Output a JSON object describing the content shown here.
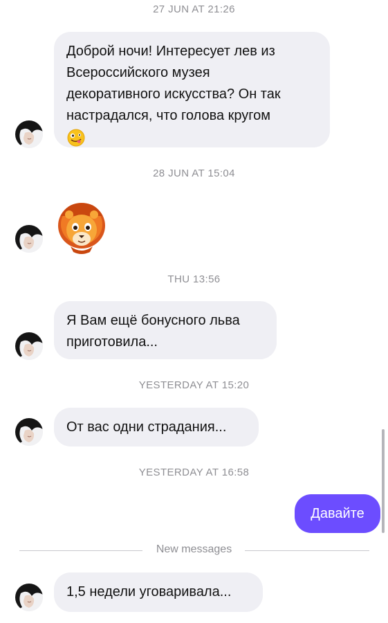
{
  "conversation": {
    "timestamps": {
      "t1": "27 JUN AT 21:26",
      "t2": "28 JUN AT 15:04",
      "t3": "THU 13:56",
      "t4": "YESTERDAY AT 15:20",
      "t5": "YESTERDAY AT 16:58"
    },
    "messages": {
      "m1_line1": "Доброй ночи! Интересует лев из",
      "m1_line2": "Всероссийского музея",
      "m1_line3": "декоративного искусства? Он так",
      "m1_line4": "настрадался, что голова кругом",
      "m1_emoji": "zany-face-emoji",
      "m2_sticker": "lion-memoji-sticker",
      "m3_line1": "Я Вам ещё бонусного льва",
      "m3_line2": "приготовила...",
      "m4": "От вас одни страдания...",
      "m5_outgoing": "Давайте",
      "m6": "1,5 недели уговаривала..."
    },
    "new_messages_label": "New messages"
  },
  "colors": {
    "incoming_bubble": "#efeff4",
    "outgoing_bubble": "#6c4dff",
    "timestamp_text": "#8e8e93"
  },
  "icons": {
    "avatar": "contact-avatar-photo"
  }
}
